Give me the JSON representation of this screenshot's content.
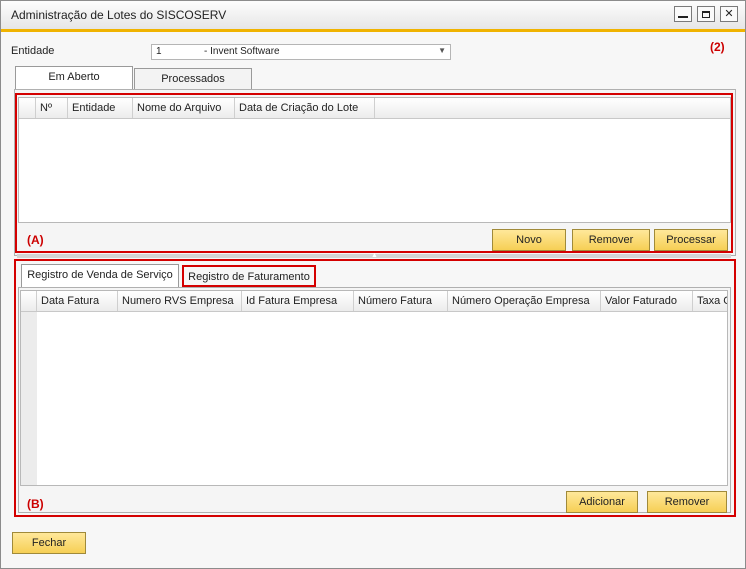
{
  "window": {
    "title": "Administração de Lotes do SISCOSERV",
    "controls": {
      "minimize": "minimize",
      "maximize": "maximize",
      "close": "close"
    }
  },
  "annotations": {
    "a": "(A)",
    "b": "(B)",
    "two": "(2)",
    "color": "#cc0000"
  },
  "entity": {
    "label": "Entidade",
    "value_code": "1",
    "value_name": "- Invent Software"
  },
  "top_tabs": [
    "Em Aberto",
    "Processados"
  ],
  "lots_grid": {
    "columns": [
      "Nº",
      "Entidade",
      "Nome do Arquivo",
      "Data de Criação do Lote"
    ],
    "rows": []
  },
  "lots_buttons": {
    "new": "Novo",
    "remove": "Remover",
    "process": "Processar"
  },
  "bottom_tabs": [
    "Registro de Venda de Serviço",
    "Registro de Faturamento"
  ],
  "billing_grid": {
    "columns": [
      "Data Fatura",
      "Numero RVS Empresa",
      "Id Fatura Empresa",
      "Número Fatura",
      "Número Operação Empresa",
      "Valor Faturado",
      "Taxa C"
    ],
    "rows": []
  },
  "billing_buttons": {
    "add": "Adicionar",
    "remove": "Remover"
  },
  "footer": {
    "close": "Fechar"
  },
  "colors": {
    "accent": "#f0b300",
    "button": "#f6cf55",
    "highlight": "#d40000"
  }
}
